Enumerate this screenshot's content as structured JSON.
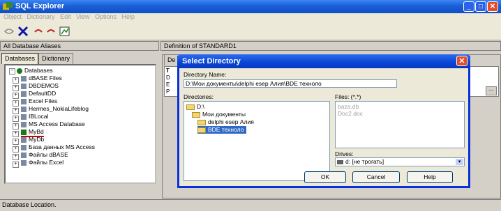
{
  "window": {
    "title": "SQL Explorer"
  },
  "menu": [
    "Object",
    "Dictionary",
    "Edit",
    "View",
    "Options",
    "Help"
  ],
  "left": {
    "header": "All Database Aliases",
    "tabs": [
      "Databases",
      "Dictionary"
    ],
    "tree_root": "Databases",
    "aliases": [
      "dBASE Files",
      "DBDEMOS",
      "DefaultDD",
      "Excel Files",
      "Hermes_NokiaLifeblog",
      "IBLocal",
      "MS Access Database",
      "MyBd",
      "MyDb",
      "База данных MS Access",
      "Файлы dBASE",
      "Файлы Excel"
    ]
  },
  "right": {
    "header": "Definition of STANDARD1",
    "tab": "De",
    "row_letters": [
      "T",
      "D",
      "E",
      "P"
    ],
    "ellipsis": "..."
  },
  "dialog": {
    "title": "Select Directory",
    "dirname_label": "Directory Name:",
    "dirname_value": "D:\\Мои документы\\delphi esep Алия\\BDE техноло",
    "directories_label": "Directories:",
    "directories": [
      "D:\\",
      "Мои документы",
      "delphi esep Алия",
      "BDE техноло"
    ],
    "files_label": "Files: (*.*)",
    "files": [
      "baza.db",
      "Doc2.doc"
    ],
    "drives_label": "Drives:",
    "drive_value": "d: [не трогать]",
    "ok": "OK",
    "cancel": "Cancel",
    "help": "Help"
  },
  "statusbar": "Database Location."
}
